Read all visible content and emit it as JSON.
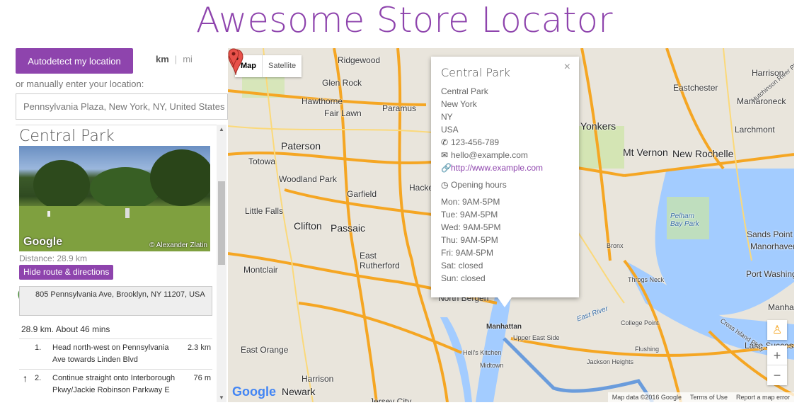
{
  "header": {
    "title": "Awesome Store Locator"
  },
  "controls": {
    "autodetect_label": "Autodetect my location",
    "unit_km": "km",
    "unit_mi": "mi",
    "unit_sep": "|",
    "manual_label": "or manually enter your location:",
    "location_value": "Pennsylvania Plaza, New York, NY, United States"
  },
  "store": {
    "name": "Central Park",
    "photo_brand": "Google",
    "photo_credit": "© Alexander Zlatin",
    "distance": "Distance: 28.9 km",
    "hide_route_label": "Hide route & directions",
    "from_address": "805 Pennsylvania Ave, Brooklyn, NY 11207, USA",
    "marker_a": "A",
    "summary": "28.9 km. About 46 mins",
    "steps": [
      {
        "num": "1.",
        "text": "Head north-west on Pennsylvania Ave towards Linden Blvd",
        "dist": "2.3 km"
      },
      {
        "num": "2.",
        "text": "Continue straight onto Interborough Pkwy/Jackie Robinson Parkway E",
        "dist": "76 m",
        "icon": "arrow-up"
      }
    ]
  },
  "map": {
    "type_map": "Map",
    "type_satellite": "Satellite",
    "brand": "Google",
    "footer": {
      "data": "Map data ©2016 Google",
      "terms": "Terms of Use",
      "report": "Report a map error"
    },
    "zoom_in": "+",
    "zoom_out": "−",
    "marker_b": "B",
    "labels": [
      "Ridgewood",
      "Glen Rock",
      "Paramus",
      "Hawthorne",
      "Fair Lawn",
      "Paterson",
      "Totowa",
      "Woodland Park",
      "Garfield",
      "Hackensack",
      "Little Falls",
      "Clifton",
      "Passaic",
      "East Rutherford",
      "Montclair",
      "North Bergen",
      "Manhattan",
      "Upper East Side",
      "Hell's Kitchen",
      "Midtown",
      "East Orange",
      "Harrison",
      "Newark",
      "Jersey City",
      "Yonkers",
      "Mt Vernon",
      "New Rochelle",
      "Harrison",
      "Eastchester",
      "Mamaroneck",
      "Larchmont",
      "Pelham Bay Park",
      "Bronx",
      "Sands Point",
      "Manorhaven",
      "Port Washington",
      "Manhasset",
      "College Point",
      "Flushing",
      "Jackson Heights",
      "Lake Success",
      "Cross Island Pkwy",
      "Hutchinson River Pkwy",
      "Throgs Neck",
      "East River"
    ]
  },
  "infowindow": {
    "title": "Central Park",
    "address_lines": [
      "Central Park",
      "New York",
      "NY",
      "USA"
    ],
    "phone": "123-456-789",
    "email": "hello@example.com",
    "url": "http://www.example.com",
    "hours_title": "Opening hours",
    "hours": [
      "Mon: 9AM-5PM",
      "Tue: 9AM-5PM",
      "Wed: 9AM-5PM",
      "Thu: 9AM-5PM",
      "Fri: 9AM-5PM",
      "Sat: closed",
      "Sun: closed"
    ],
    "close": "×"
  },
  "colors": {
    "accent": "#8e44ad",
    "road": "#f5a623",
    "water": "#a3ccff",
    "route": "#4a89dc"
  }
}
